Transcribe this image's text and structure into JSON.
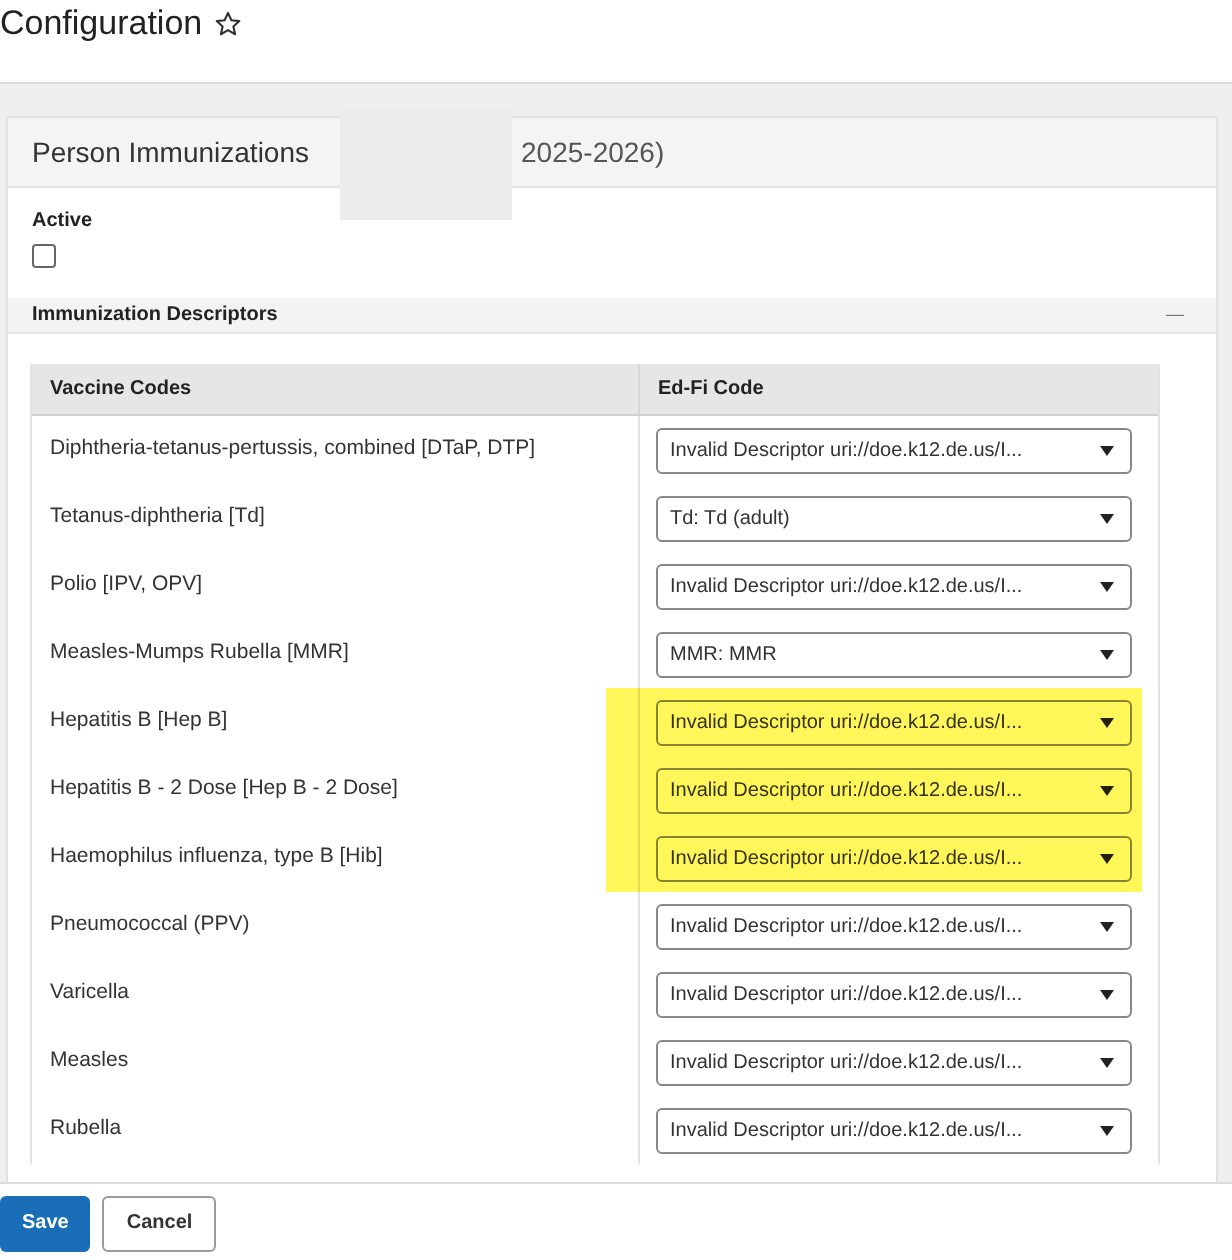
{
  "page": {
    "title": "Configuration",
    "favorite": false
  },
  "card": {
    "title_start": "Person Immunizations",
    "title_end": "2025-2026)",
    "redacted": true
  },
  "active": {
    "label": "Active",
    "checked": false
  },
  "section": {
    "title": "Immunization Descriptors",
    "expanded": true,
    "toggle": "—"
  },
  "table": {
    "columns": [
      "Vaccine Codes",
      "Ed-Fi Code"
    ],
    "rows": [
      {
        "vaccine": "Diphtheria-tetanus-pertussis, combined [DTaP, DTP]",
        "edfi": "Invalid Descriptor uri://doe.k12.de.us/I...",
        "highlighted": false
      },
      {
        "vaccine": "Tetanus-diphtheria [Td]",
        "edfi": "Td: Td (adult)",
        "highlighted": false
      },
      {
        "vaccine": "Polio [IPV, OPV]",
        "edfi": "Invalid Descriptor uri://doe.k12.de.us/I...",
        "highlighted": false
      },
      {
        "vaccine": "Measles-Mumps Rubella [MMR]",
        "edfi": "MMR: MMR",
        "highlighted": false
      },
      {
        "vaccine": "Hepatitis B [Hep B]",
        "edfi": "Invalid Descriptor uri://doe.k12.de.us/I...",
        "highlighted": true
      },
      {
        "vaccine": "Hepatitis B - 2 Dose [Hep B - 2 Dose]",
        "edfi": "Invalid Descriptor uri://doe.k12.de.us/I...",
        "highlighted": true
      },
      {
        "vaccine": "Haemophilus influenza, type B [Hib]",
        "edfi": "Invalid Descriptor uri://doe.k12.de.us/I...",
        "highlighted": true
      },
      {
        "vaccine": "Pneumococcal (PPV)",
        "edfi": "Invalid Descriptor uri://doe.k12.de.us/I...",
        "highlighted": false
      },
      {
        "vaccine": "Varicella",
        "edfi": "Invalid Descriptor uri://doe.k12.de.us/I...",
        "highlighted": false
      },
      {
        "vaccine": "Measles",
        "edfi": "Invalid Descriptor uri://doe.k12.de.us/I...",
        "highlighted": false
      },
      {
        "vaccine": "Rubella",
        "edfi": "Invalid Descriptor uri://doe.k12.de.us/I...",
        "highlighted": false
      }
    ]
  },
  "buttons": [
    {
      "label": "Save",
      "kind": "primary"
    },
    {
      "label": "Cancel",
      "kind": "secondary"
    }
  ]
}
